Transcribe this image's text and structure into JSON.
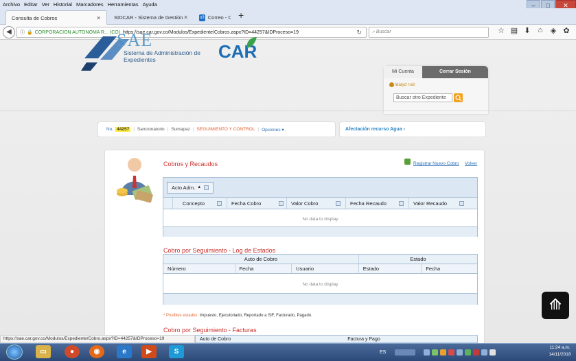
{
  "menubar": {
    "items": [
      "Archivo",
      "Editar",
      "Ver",
      "Historial",
      "Marcadores",
      "Herramientas",
      "Ayuda"
    ]
  },
  "window_controls": {
    "minimize": "–",
    "maximize": "□",
    "close": "✕"
  },
  "tabs": [
    {
      "label": "Consulta de Cobros",
      "icon": "",
      "active": true
    },
    {
      "label": "SIDCAR - Sistema de Gestión Doc",
      "icon": "",
      "active": false
    },
    {
      "label": "Correo - Dianitha_admon@",
      "icon": "o3",
      "active": false
    }
  ],
  "new_tab": "+",
  "navbar": {
    "url_host": "CORPORACION AUTONOMA R... (CO)",
    "url": "https://sae.car.gov.co/Modulos/Expediente/Cobros.aspx?ID=44257&IDProceso=19",
    "search_placeholder": "Buscar"
  },
  "header": {
    "logo_sae": "SAE",
    "logo_sae_sub": "Sistema de Administración de Expedientes",
    "logo_car": "CAR",
    "mi_cuenta": "Mi Cuenta",
    "cerrar_sesion": "Cerrar Sesión",
    "username": "Idalyd ruiz",
    "search_placeholder": "Buscar otro Expediente"
  },
  "breadcrumb": {
    "no_label": "No.",
    "expediente": "44257",
    "items": [
      "Sancionatorio",
      "Sumapaz"
    ],
    "seguimiento": "SEGUIMIENTO Y CONTROL",
    "opciones": "Opciones",
    "afectacion": "Afectación recurso Agua"
  },
  "section1": {
    "title": "Cobros y Recaudos",
    "registrar": "Registrar Nuevo Cobro",
    "volver": "Volver",
    "group_chip": "Acto Adm.",
    "columns": [
      "Concepto",
      "Fecha Cobro",
      "Valor Cobro",
      "Fecha Recaudo",
      "Valor Recaudo"
    ],
    "empty": "No data to display"
  },
  "section2": {
    "title": "Cobro por Seguimiento - Log de Estados",
    "group_headers": [
      "Auto de Cobro",
      "Estado"
    ],
    "columns": [
      "Número",
      "Fecha",
      "Usuario",
      "Estado",
      "Fecha"
    ],
    "empty": "No data to display",
    "posibles_label": "* Posibles estados:",
    "posibles_text": "Impuesto, Ejecutoriado, Reportado a SIF, Facturado, Pagado."
  },
  "section3": {
    "title": "Cobro por Seguimiento - Facturas",
    "group_headers": [
      "Auto de Cobro",
      "Factura y Pago"
    ]
  },
  "status_url": "https://sae.car.gov.co/Modulos/Expediente/Cobro.aspx?ID=44257&IDProceso=19",
  "taskbar": {
    "lang": "ES",
    "clock_time": "11:24 a.m.",
    "clock_date": "14/11/2018"
  }
}
